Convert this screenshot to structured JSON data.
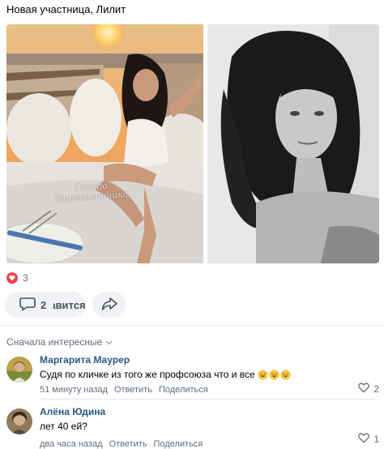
{
  "post": {
    "text": "Новая участница, Лилит",
    "watermark_line1": "Гнездо",
    "watermark_line2": "Переселенчика"
  },
  "reactions": {
    "likes_count": "3",
    "heart_color": "#e64646"
  },
  "actions": {
    "like_label": "Нравится",
    "comments_count": "2",
    "like_icon": "heart-outline-icon",
    "comment_icon": "speech-bubble-icon",
    "share_icon": "share-arrow-icon"
  },
  "comments_section": {
    "sort_label": "Сначала интересные"
  },
  "comments": [
    {
      "author": "Маргарита Маурер",
      "text": "Судя по кличке из того же профсоюза что и все",
      "time": "51 минуту назад",
      "reply_label": "Ответить",
      "share_label": "Поделиться",
      "likes": "2",
      "emoji": "laughing-emoji"
    },
    {
      "author": "Алёна Юдина",
      "text": "лет 40 ей?",
      "time": "два часа назад",
      "reply_label": "Ответить",
      "share_label": "Поделиться",
      "likes": "1"
    }
  ],
  "colors": {
    "author_link": "#2a5885",
    "secondary_text": "#626d7a",
    "pill_bg": "#f0f2f5"
  }
}
